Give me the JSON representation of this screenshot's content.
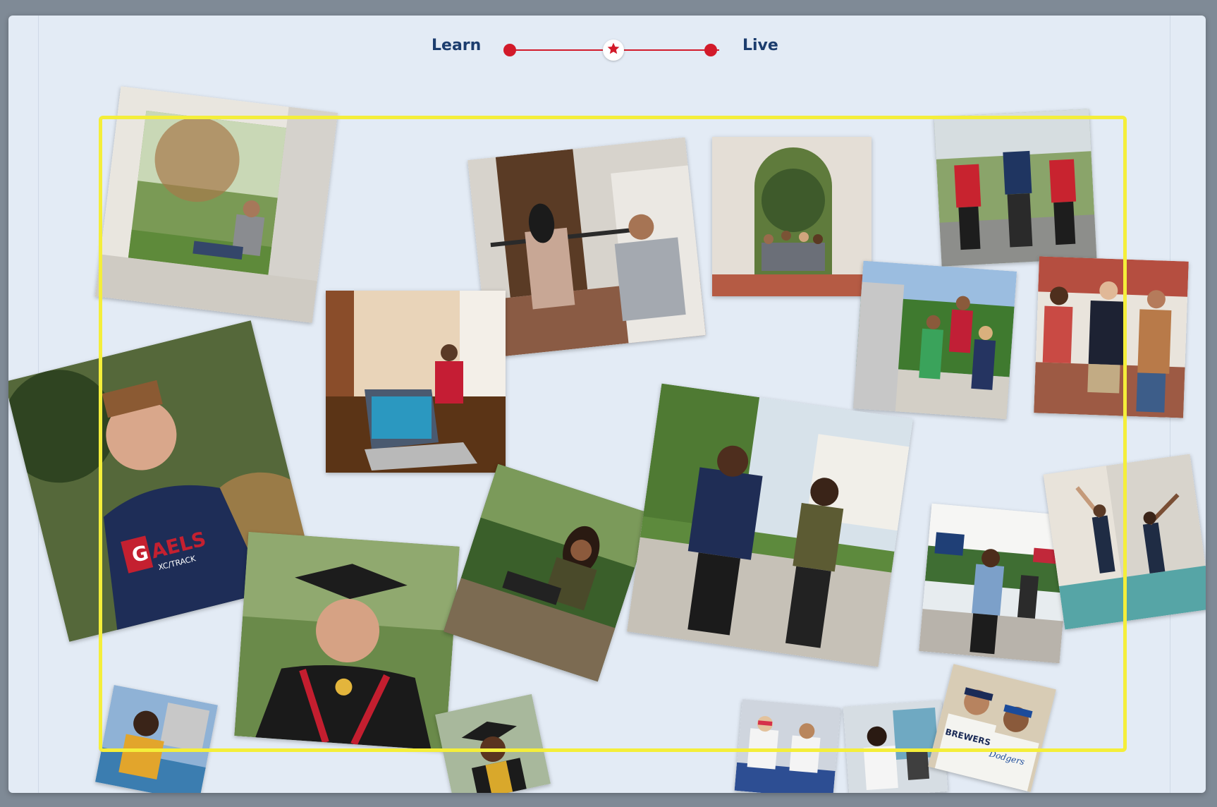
{
  "slider": {
    "left_label": "Learn",
    "right_label": "Live",
    "knob_icon": "star-icon",
    "accent_color": "#d21a2a",
    "label_color": "#1c3d6e"
  },
  "frame": {
    "color": "#f4ee3a"
  },
  "gaels_shirt": {
    "text": "AELS",
    "subtext": "XC/TRACK"
  },
  "brewers_jersey": "BREWERS",
  "dodgers_jersey": "Dodgers",
  "photos": [
    "student-window-reading",
    "students-stairs-conversation",
    "students-archway-group",
    "students-running",
    "classroom-laptops",
    "students-campus-tour",
    "students-walking-campus",
    "student-gaels-shirt",
    "student-graduate",
    "student-sitting-grass",
    "students-walking-smiling",
    "student-campus-walk",
    "dance-class",
    "student-lake",
    "graduate-smiling",
    "students-lab",
    "student-lab-microscope",
    "baseball-fans"
  ]
}
